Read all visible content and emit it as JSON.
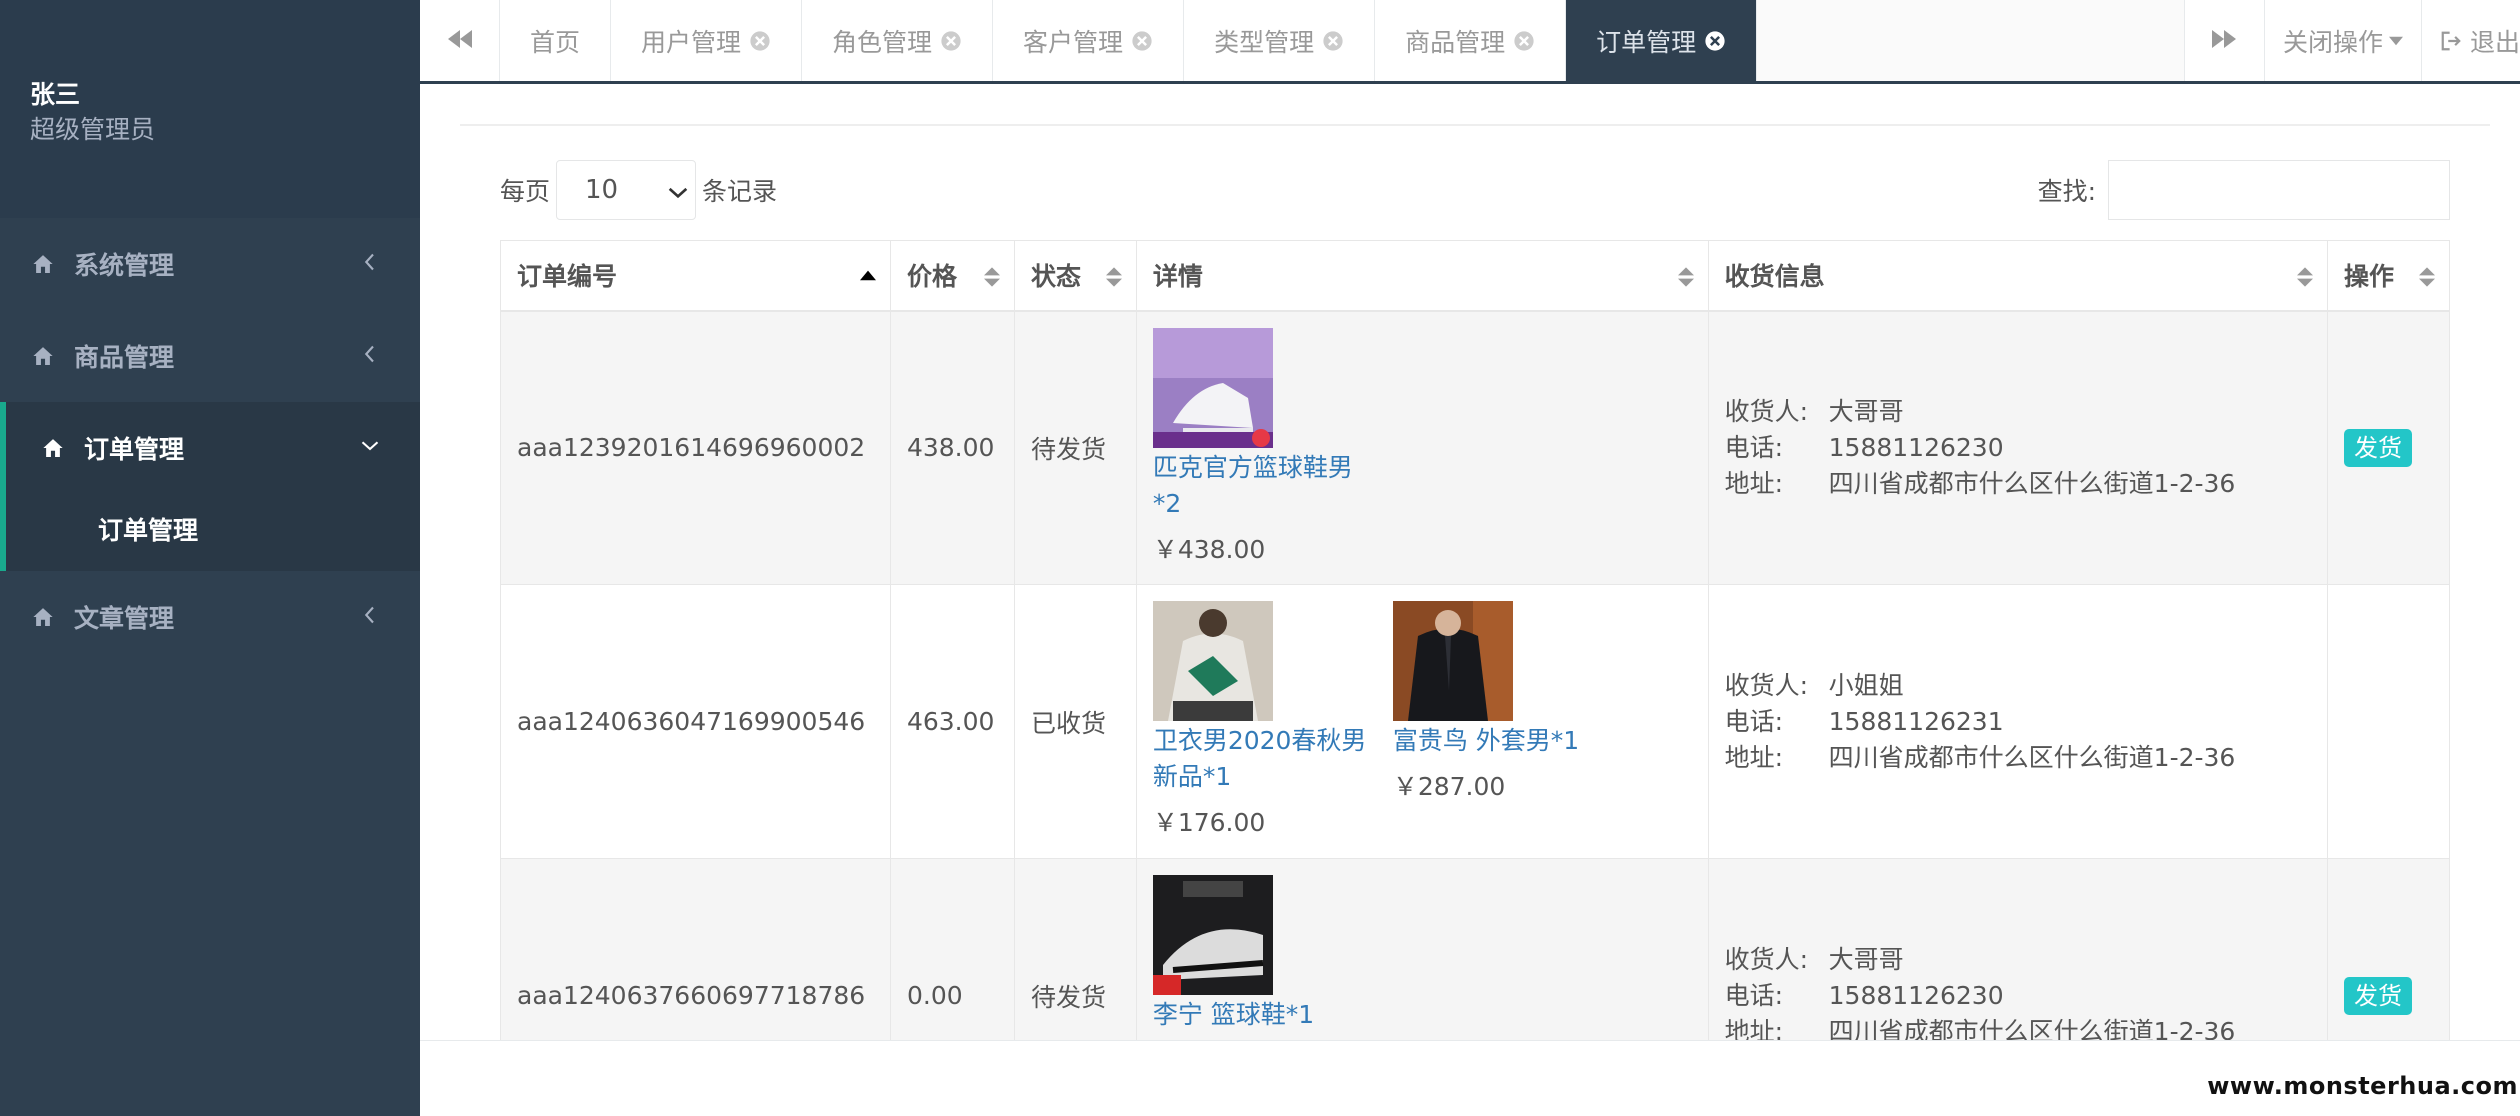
{
  "sidebar": {
    "user_name": "张三",
    "user_role": "超级管理员",
    "menu": [
      {
        "label": "系统管理",
        "icon": "home-icon",
        "expanded": false
      },
      {
        "label": "商品管理",
        "icon": "home-icon",
        "expanded": false
      },
      {
        "label": "订单管理",
        "icon": "home-icon",
        "expanded": true,
        "children": [
          {
            "label": "订单管理"
          }
        ]
      },
      {
        "label": "文章管理",
        "icon": "home-icon",
        "expanded": false
      }
    ]
  },
  "tabbar": {
    "tabs": [
      {
        "label": "首页",
        "closable": false,
        "active": false
      },
      {
        "label": "用户管理",
        "closable": true,
        "active": false
      },
      {
        "label": "角色管理",
        "closable": true,
        "active": false
      },
      {
        "label": "客户管理",
        "closable": true,
        "active": false
      },
      {
        "label": "类型管理",
        "closable": true,
        "active": false
      },
      {
        "label": "商品管理",
        "closable": true,
        "active": false
      },
      {
        "label": "订单管理",
        "closable": true,
        "active": true
      }
    ],
    "close_ops_label": "关闭操作",
    "logout_label": "退出"
  },
  "listing": {
    "per_page_prefix": "每页",
    "per_page_value": "10",
    "per_page_suffix": "条记录",
    "search_label": "查找:",
    "search_value": ""
  },
  "table": {
    "columns": [
      "订单编号",
      "价格",
      "状态",
      "详情",
      "收货信息",
      "操作"
    ],
    "receiver_labels": {
      "name": "收货人:",
      "phone": "电话:",
      "address": "地址:"
    },
    "rows": [
      {
        "order_no": "aaa1239201614696960002",
        "price": "438.00",
        "status": "待发货",
        "items": [
          {
            "name": "匹克官方篮球鞋男*2",
            "price": "￥438.00",
            "thumb": "shoe-photo"
          }
        ],
        "receiver": "大哥哥",
        "phone": "15881126230",
        "address": "四川省成都市什么区什么街道1-2-36",
        "action": "发货"
      },
      {
        "order_no": "aaa1240636047169900546",
        "price": "463.00",
        "status": "已收货",
        "items": [
          {
            "name": "卫衣男2020春秋男新品*1",
            "price": "￥176.00",
            "thumb": "hoodie-photo"
          },
          {
            "name": "富贵鸟 外套男*1",
            "price": "￥287.00",
            "thumb": "jacket-photo"
          }
        ],
        "receiver": "小姐姐",
        "phone": "15881126231",
        "address": "四川省成都市什么区什么街道1-2-36",
        "action": ""
      },
      {
        "order_no": "aaa1240637660697718786",
        "price": "0.00",
        "status": "待发货",
        "items": [
          {
            "name": "李宁 篮球鞋*1",
            "price": "",
            "thumb": "basketball-shoe-photo"
          }
        ],
        "receiver": "大哥哥",
        "phone": "15881126230",
        "address": "四川省成都市什么区什么街道1-2-36",
        "action": "发货"
      }
    ]
  },
  "watermark": "www.monsterhua.com",
  "colors": {
    "sidebar_bg": "#2f4050",
    "accent": "#19aa8d",
    "ship_button": "#23c6c8",
    "link": "#337ab7"
  }
}
